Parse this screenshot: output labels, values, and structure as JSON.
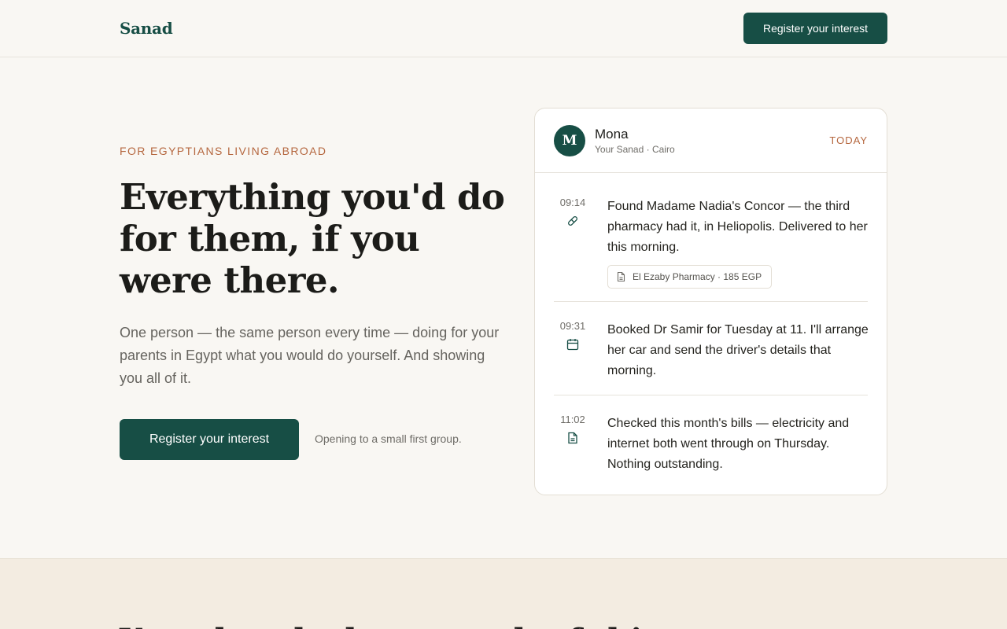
{
  "header": {
    "logo": "Sanad",
    "cta_label": "Register your interest"
  },
  "hero": {
    "eyebrow": "FOR EGYPTIANS LIVING ABROAD",
    "headline": "Everything you'd do for them, if you were there.",
    "lede": "One person — the same person every time — doing for your parents in Egypt what you would do yourself. And showing you all of it.",
    "cta_label": "Register your interest",
    "note": "Opening to a small first group."
  },
  "card": {
    "avatar_initial": "M",
    "name": "Mona",
    "subtitle": "Your Sanad · Cairo",
    "day_label": "TODAY",
    "entries": [
      {
        "time": "09:14",
        "icon": "pill-icon",
        "text": "Found Madame Nadia's Concor — the third pharmacy had it, in Heliopolis. Delivered to her this morning.",
        "receipt": "El Ezaby Pharmacy · 185 EGP"
      },
      {
        "time": "09:31",
        "icon": "calendar-icon",
        "text": "Booked Dr Samir for Tuesday at 11. I'll arrange her car and send the driver's details that morning."
      },
      {
        "time": "11:02",
        "icon": "document-icon",
        "text": "Checked this month's bills — electricity and internet both went through on Thursday. Nothing outstanding."
      }
    ]
  },
  "band": {
    "title": "You already do so much of this"
  },
  "colors": {
    "brand": "#174e45",
    "accent": "#b5673f",
    "background": "#f9f7f3",
    "band": "#f3ece1"
  }
}
